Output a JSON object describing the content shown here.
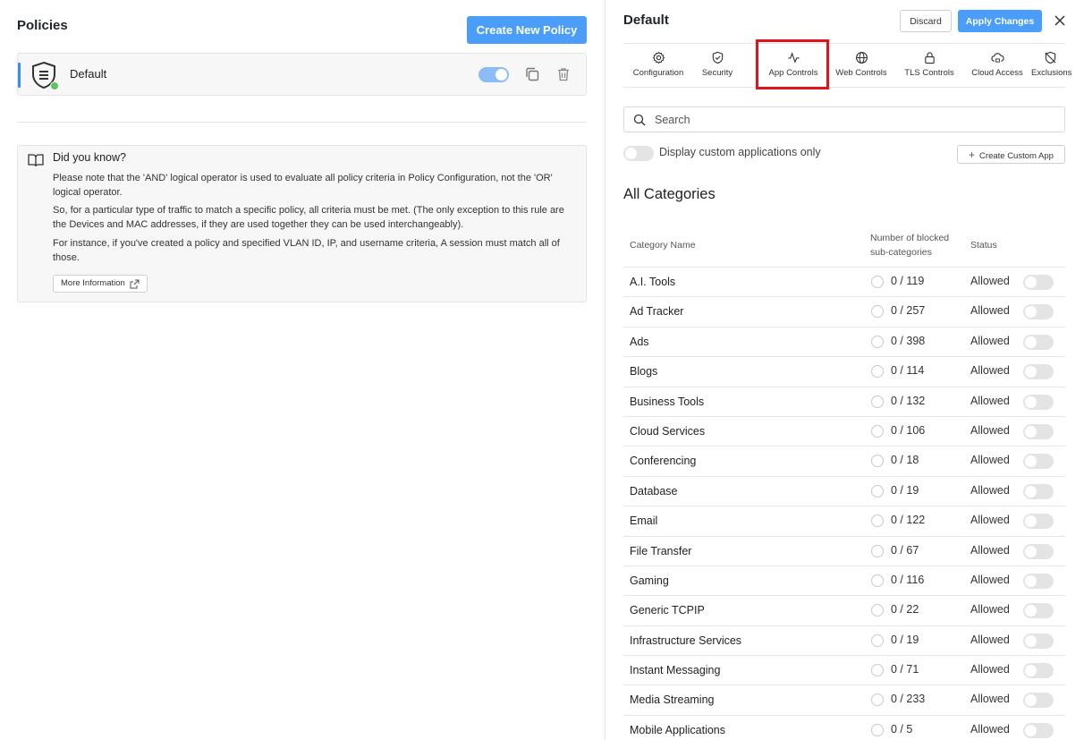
{
  "left": {
    "title": "Policies",
    "create_button": "Create New Policy",
    "policy": {
      "name": "Default",
      "enabled": true,
      "status_color": "#5cc55a"
    },
    "info": {
      "title": "Did you know?",
      "p1": "Please note that the 'AND' logical operator is used to evaluate all policy criteria in Policy Configuration, not the 'OR' logical operator.",
      "p2": "So, for a particular type of traffic to match a specific policy, all criteria must be met. (The only exception to this rule are the Devices and MAC addresses, if they are used together they can be used interchangeably).",
      "p3": "For instance, if you've created a policy and specified VLAN ID, IP, and username criteria, A session must match all of those.",
      "more_button": "More Information"
    }
  },
  "right": {
    "title": "Default",
    "discard": "Discard",
    "apply": "Apply Changes",
    "tabs": [
      {
        "label": "Configuration",
        "icon": "gear-icon"
      },
      {
        "label": "Security",
        "icon": "shield-check-icon"
      },
      {
        "label": "App Controls",
        "icon": "activity-icon",
        "highlighted": true
      },
      {
        "label": "Web Controls",
        "icon": "globe-icon"
      },
      {
        "label": "TLS Controls",
        "icon": "lock-icon"
      },
      {
        "label": "Cloud Access",
        "icon": "cloud-lock-icon"
      },
      {
        "label": "Exclusions",
        "icon": "shield-off-icon"
      }
    ],
    "search_placeholder": "Search",
    "custom_only_label": "Display custom applications only",
    "create_custom": "Create Custom App",
    "section_title": "All Categories",
    "columns": {
      "name": "Category Name",
      "count_line1": "Number of blocked",
      "count_line2": "sub-categories",
      "status": "Status"
    },
    "categories": [
      {
        "name": "A.I. Tools",
        "blocked": "0 / 119",
        "status": "Allowed"
      },
      {
        "name": "Ad Tracker",
        "blocked": "0 / 257",
        "status": "Allowed"
      },
      {
        "name": "Ads",
        "blocked": "0 / 398",
        "status": "Allowed"
      },
      {
        "name": "Blogs",
        "blocked": "0 / 114",
        "status": "Allowed"
      },
      {
        "name": "Business Tools",
        "blocked": "0 / 132",
        "status": "Allowed"
      },
      {
        "name": "Cloud Services",
        "blocked": "0 / 106",
        "status": "Allowed"
      },
      {
        "name": "Conferencing",
        "blocked": "0 / 18",
        "status": "Allowed"
      },
      {
        "name": "Database",
        "blocked": "0 / 19",
        "status": "Allowed"
      },
      {
        "name": "Email",
        "blocked": "0 / 122",
        "status": "Allowed"
      },
      {
        "name": "File Transfer",
        "blocked": "0 / 67",
        "status": "Allowed"
      },
      {
        "name": "Gaming",
        "blocked": "0 / 116",
        "status": "Allowed"
      },
      {
        "name": "Generic TCPIP",
        "blocked": "0 / 22",
        "status": "Allowed"
      },
      {
        "name": "Infrastructure Services",
        "blocked": "0 / 19",
        "status": "Allowed"
      },
      {
        "name": "Instant Messaging",
        "blocked": "0 / 71",
        "status": "Allowed"
      },
      {
        "name": "Media Streaming",
        "blocked": "0 / 233",
        "status": "Allowed"
      },
      {
        "name": "Mobile Applications",
        "blocked": "0 / 5",
        "status": "Allowed"
      }
    ]
  },
  "colors": {
    "primary": "#4a9df8",
    "highlight": "#e3121b",
    "accent": "#3b8ef0"
  }
}
